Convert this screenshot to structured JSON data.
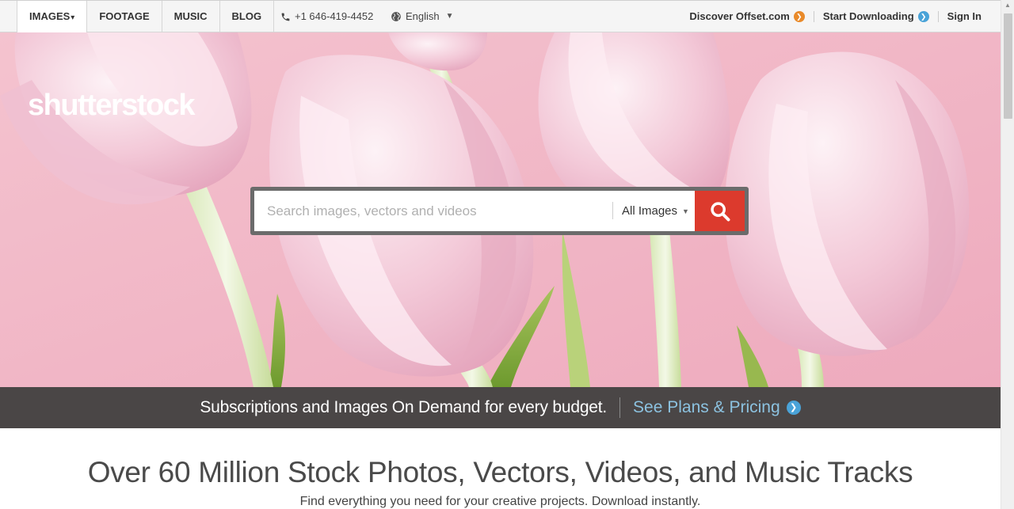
{
  "nav": {
    "tabs": [
      {
        "label": "IMAGES",
        "active": true,
        "caret": "▾"
      },
      {
        "label": "FOOTAGE"
      },
      {
        "label": "MUSIC"
      },
      {
        "label": "BLOG"
      }
    ],
    "phone": "+1 646-419-4452",
    "language": "English",
    "links": [
      {
        "label": "Discover Offset.com",
        "accent": "#e98a2a"
      },
      {
        "label": "Start Downloading",
        "accent": "#4aa3d8"
      },
      {
        "label": "Sign In"
      }
    ]
  },
  "hero": {
    "logo": "shutterstock",
    "search_placeholder": "Search images, vectors and videos",
    "search_type": "All Images",
    "search_button_color": "#dc3a2d"
  },
  "banner": {
    "text": "Subscriptions and Images On Demand for every budget.",
    "link": "See Plans & Pricing"
  },
  "main": {
    "headline": "Over 60 Million Stock Photos, Vectors, Videos, and Music Tracks",
    "subline": "Find everything you need for your creative projects. Download instantly."
  }
}
